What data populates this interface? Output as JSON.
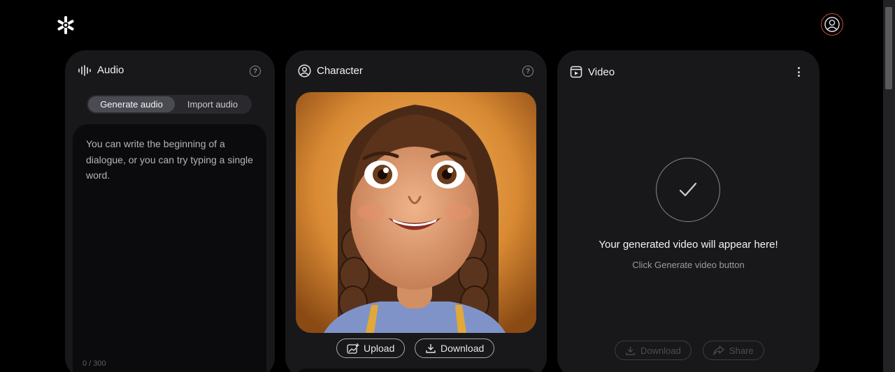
{
  "app": {
    "logo_icon": "asterisk-logo-icon",
    "profile_icon": "user-icon",
    "profile_ring_color": "#c9463f"
  },
  "audio": {
    "title": "Audio",
    "tabs": [
      {
        "label": "Generate audio",
        "active": true
      },
      {
        "label": "Import audio",
        "active": false
      }
    ],
    "placeholder": "You can write the beginning of a dialogue, or you can try typing a single word.",
    "char_count": "0 / 300"
  },
  "character": {
    "title": "Character",
    "upload_label": "Upload",
    "download_label": "Download"
  },
  "video": {
    "title": "Video",
    "empty_title": "Your generated video will appear here!",
    "empty_hint": "Click Generate video button",
    "download_label": "Download",
    "share_label": "Share"
  }
}
